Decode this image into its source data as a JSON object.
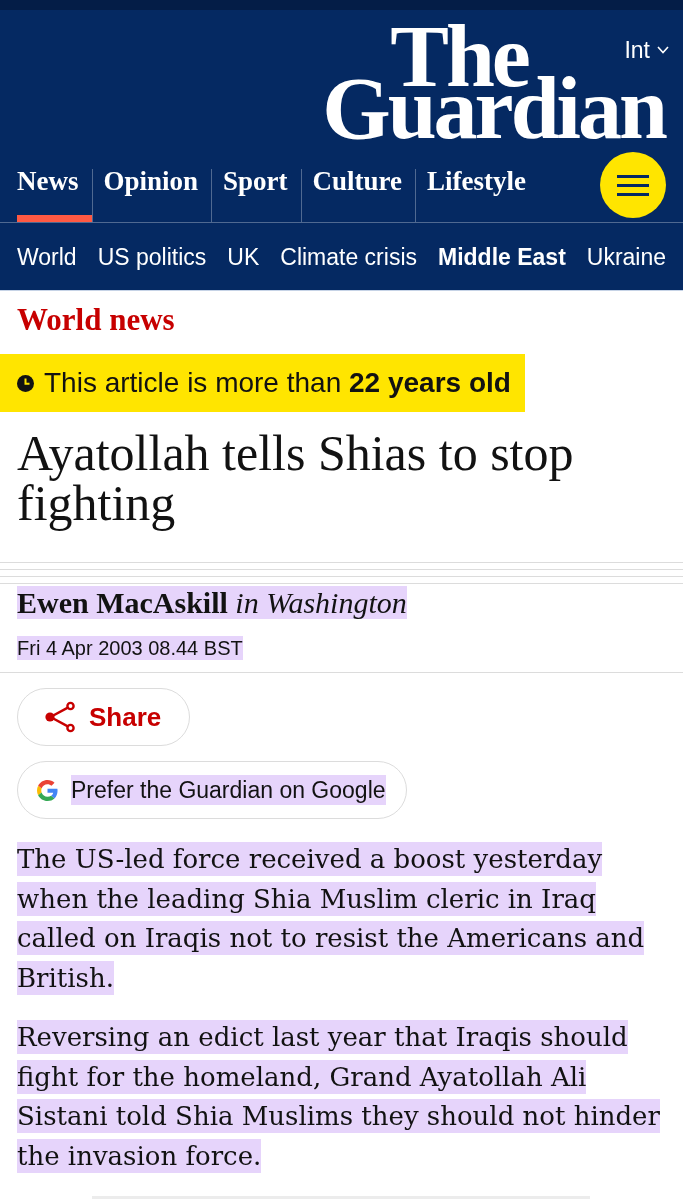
{
  "header": {
    "logo": {
      "line_1": "The",
      "line_2": "Guardian"
    },
    "edition": "Int",
    "pillars": [
      {
        "label": "News",
        "selected": true
      },
      {
        "label": "Opinion",
        "selected": false
      },
      {
        "label": "Sport",
        "selected": false
      },
      {
        "label": "Culture",
        "selected": false
      },
      {
        "label": "Lifestyle",
        "selected": false
      }
    ],
    "subnav": [
      {
        "label": "World",
        "selected": false
      },
      {
        "label": "US politics",
        "selected": false
      },
      {
        "label": "UK",
        "selected": false
      },
      {
        "label": "Climate crisis",
        "selected": false
      },
      {
        "label": "Middle East",
        "selected": true
      },
      {
        "label": "Ukraine",
        "selected": false
      }
    ]
  },
  "article": {
    "section": "World news",
    "age_notice": "This article is more than **22 years old**",
    "headline": "Ayatollah tells Shias to stop fighting",
    "byline": {
      "text": "**Ewen MacAskill** *in Washington*",
      "highlighted": true
    },
    "dateline": {
      "text": "Fri 4 Apr 2003 08.44 BST",
      "highlighted": true
    },
    "share_button": {
      "label": "Share"
    },
    "google_button": {
      "label": "Prefer the Guardian on Google",
      "highlighted": true
    },
    "paragraphs": [
      {
        "text": "The US-led force received a boost yesterday when the leading Shia Muslim cleric in Iraq called on Iraqis not to resist the Americans and British.",
        "highlighted": true
      },
      {
        "text": "Reversing an edict last year that Iraqis should fight for the homeland, Grand Ayatollah Ali Sistani told Shia Muslims they should not hinder the invasion force.",
        "highlighted": true
      }
    ]
  }
}
